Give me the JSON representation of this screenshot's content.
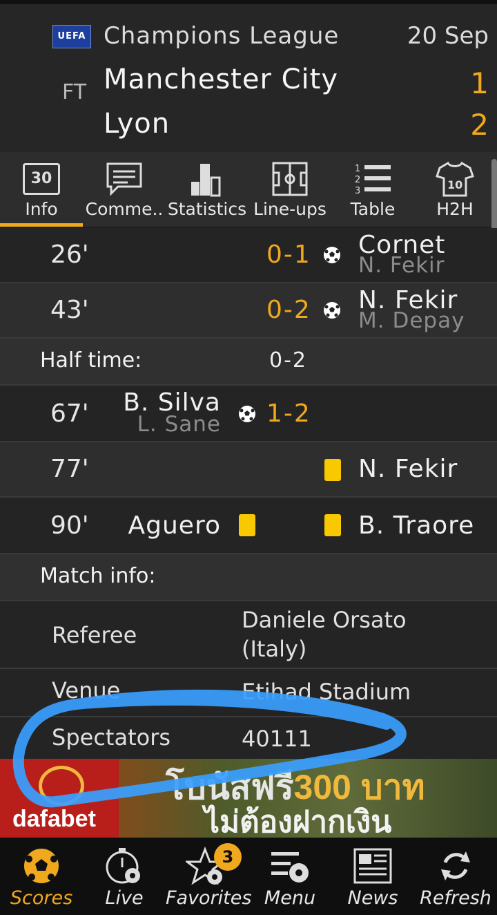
{
  "match": {
    "competition": "Champions League",
    "competition_logo_text": "UEFA",
    "date": "20 Sep",
    "status": "FT",
    "home_team": "Manchester City",
    "away_team": "Lyon",
    "home_score": "1",
    "away_score": "2"
  },
  "tabs": [
    {
      "label": "Info",
      "icon": "scoreboard-icon",
      "icon_text": "30",
      "active": true
    },
    {
      "label": "Comme..",
      "icon": "comment-icon"
    },
    {
      "label": "Statistics",
      "icon": "statistics-icon"
    },
    {
      "label": "Line-ups",
      "icon": "lineups-icon"
    },
    {
      "label": "Table",
      "icon": "table-icon",
      "icon_text": "1 2 3"
    },
    {
      "label": "H2H",
      "icon": "shirt-icon",
      "icon_text": "10"
    }
  ],
  "events": [
    {
      "minute": "26'",
      "score": "0-1",
      "side": "away",
      "type": "goal",
      "player": "Cornet",
      "assist": "N. Fekir"
    },
    {
      "minute": "43'",
      "score": "0-2",
      "side": "away",
      "type": "goal",
      "player": "N. Fekir",
      "assist": "M. Depay"
    },
    {
      "minute": "67'",
      "score": "1-2",
      "side": "home",
      "type": "goal",
      "player": "B. Silva",
      "assist": "L. Sane"
    },
    {
      "minute": "77'",
      "side": "away",
      "type": "yellow-card",
      "player": "N. Fekir"
    },
    {
      "minute": "90'",
      "type": "yellow-cards",
      "home_player": "Aguero",
      "away_player": "B. Traore"
    }
  ],
  "halftime": {
    "label": "Half time:",
    "score": "0-2"
  },
  "match_info": {
    "title": "Match info:",
    "referee_label": "Referee",
    "referee_value_line1": "Daniele Orsato",
    "referee_value_line2": "(Italy)",
    "venue_label": "Venue",
    "venue_value": "Etihad Stadium",
    "spectators_label": "Spectators",
    "spectators_value": "40111"
  },
  "ad": {
    "brand": "dafabet",
    "line1_prefix": "โบนัสฟรี",
    "line1_amount": "300 บาท",
    "line2": "ไม่ต้องฝากเงิน"
  },
  "bottom_nav": [
    {
      "label": "Scores",
      "icon": "soccer-ball-icon",
      "active": true
    },
    {
      "label": "Live",
      "icon": "stopwatch-ball-icon"
    },
    {
      "label": "Favorites",
      "icon": "star-ball-icon",
      "badge": "3"
    },
    {
      "label": "Menu",
      "icon": "menu-ball-icon"
    },
    {
      "label": "News",
      "icon": "newspaper-icon"
    },
    {
      "label": "Refresh",
      "icon": "refresh-icon"
    }
  ],
  "colors": {
    "accent": "#f0a81e",
    "highlight_stroke": "#3aa0ff",
    "yellow_card": "#f8c800"
  }
}
